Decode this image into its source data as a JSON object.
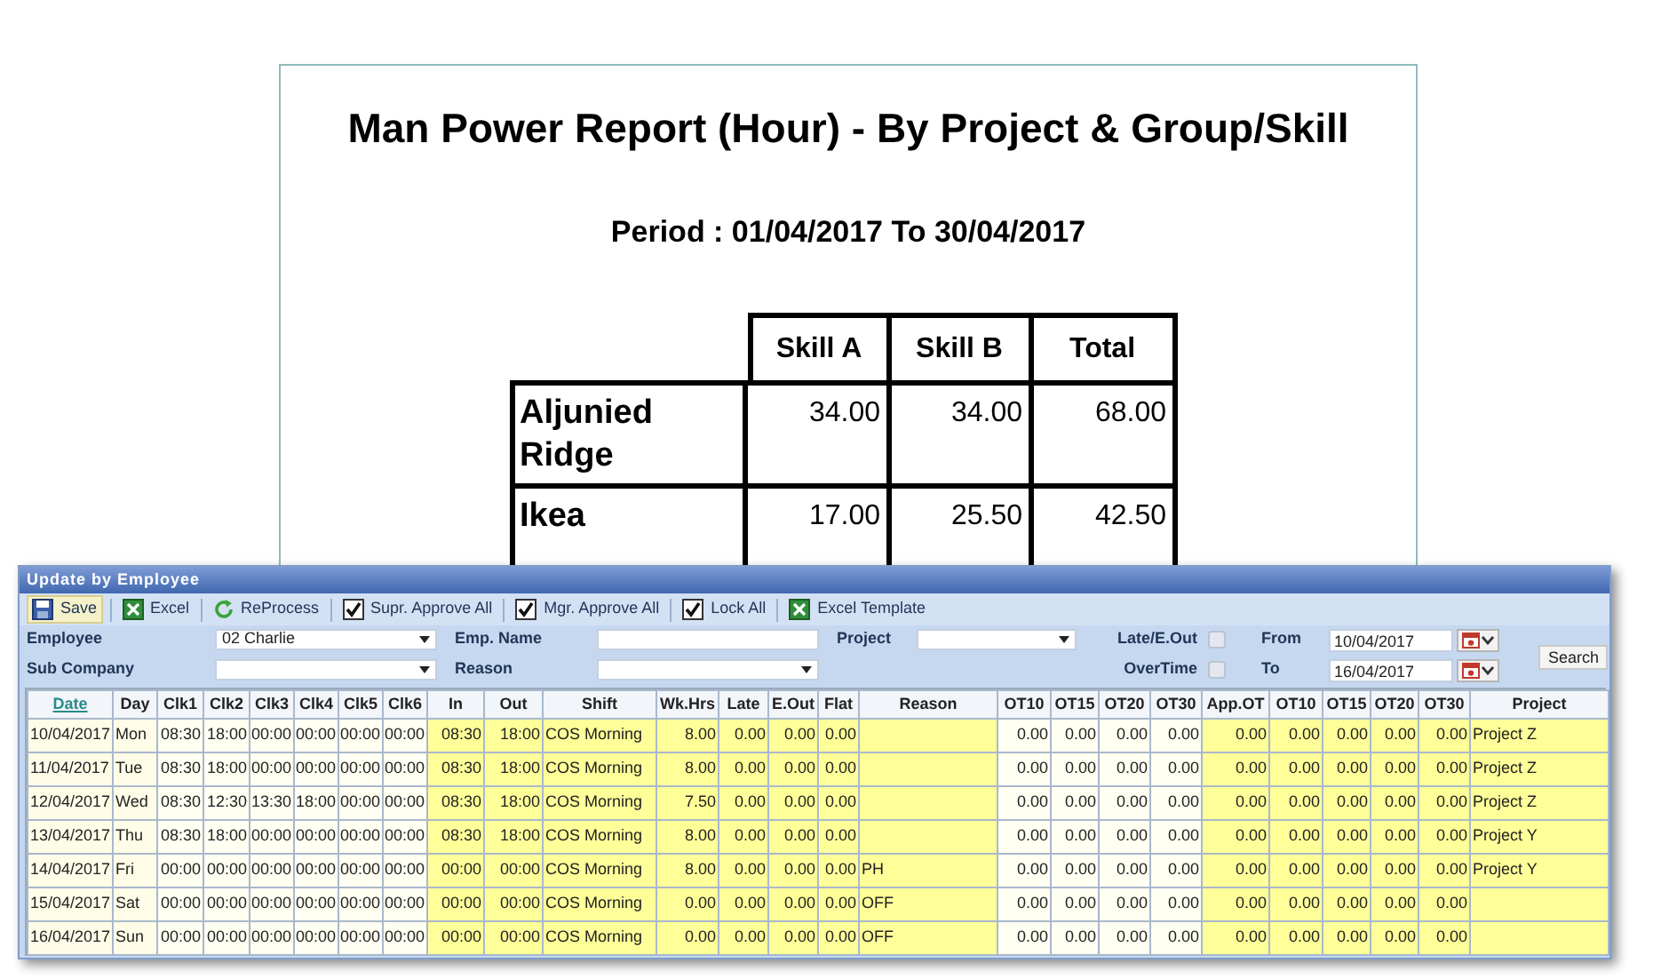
{
  "report": {
    "title": "Man Power Report (Hour) - By Project & Group/Skill",
    "period": "Period : 01/04/2017 To 30/04/2017",
    "columns": [
      "Skill A",
      "Skill B",
      "Total"
    ],
    "rows": [
      {
        "label": "Aljunied Ridge",
        "values": [
          "34.00",
          "34.00",
          "68.00"
        ]
      },
      {
        "label": "Ikea",
        "values": [
          "17.00",
          "25.50",
          "42.50"
        ]
      }
    ]
  },
  "window": {
    "title": "Update by Employee",
    "toolbar": [
      {
        "kind": "save",
        "label": "Save"
      },
      {
        "kind": "excel",
        "label": "Excel"
      },
      {
        "kind": "reprocess",
        "label": "ReProcess"
      },
      {
        "kind": "checkbox",
        "label": "Supr. Approve All",
        "checked": true
      },
      {
        "kind": "checkbox",
        "label": "Mgr. Approve All",
        "checked": true
      },
      {
        "kind": "checkbox",
        "label": "Lock All",
        "checked": true
      },
      {
        "kind": "excel",
        "label": "Excel Template"
      }
    ],
    "filter_groups": [
      [
        {
          "label": "Employee",
          "kind": "dropdown",
          "value": "02 Charlie"
        },
        {
          "label": "Sub Company",
          "kind": "dropdown"
        }
      ],
      [
        {
          "label": "Emp. Name",
          "kind": "input"
        },
        {
          "label": "Reason",
          "kind": "dropdown"
        }
      ],
      [
        {
          "label": "Project",
          "kind": "dropdown"
        }
      ],
      [
        {
          "label": "Late/E.Out",
          "kind": "checkbox",
          "checked": false
        },
        {
          "label": "OverTime",
          "kind": "checkbox",
          "checked": false
        }
      ],
      [
        {
          "label": "From",
          "kind": "date",
          "value": "10/04/2017"
        },
        {
          "label": "To",
          "kind": "date",
          "value": "16/04/2017"
        }
      ]
    ],
    "search_button": "Search",
    "columns": [
      {
        "label": "Date",
        "kind": "date",
        "highlight": false,
        "link": true
      },
      {
        "label": "Day",
        "kind": "day",
        "highlight": false
      },
      {
        "label": "Clk1",
        "kind": "num",
        "highlight": false
      },
      {
        "label": "Clk2",
        "kind": "num",
        "highlight": false
      },
      {
        "label": "Clk3",
        "kind": "num",
        "highlight": false
      },
      {
        "label": "Clk4",
        "kind": "num",
        "highlight": false
      },
      {
        "label": "Clk5",
        "kind": "num",
        "highlight": false
      },
      {
        "label": "Clk6",
        "kind": "num",
        "highlight": false
      },
      {
        "label": "In",
        "kind": "num",
        "highlight": true
      },
      {
        "label": "Out",
        "kind": "num",
        "highlight": true
      },
      {
        "label": "Shift",
        "kind": "text",
        "highlight": true
      },
      {
        "label": "Wk.Hrs",
        "kind": "num",
        "highlight": true
      },
      {
        "label": "Late",
        "kind": "num",
        "highlight": true
      },
      {
        "label": "E.Out",
        "kind": "num",
        "highlight": true
      },
      {
        "label": "Flat",
        "kind": "num",
        "highlight": true
      },
      {
        "label": "Reason",
        "kind": "text",
        "highlight": true
      },
      {
        "label": "OT10",
        "kind": "num",
        "highlight": false
      },
      {
        "label": "OT15",
        "kind": "num",
        "highlight": false
      },
      {
        "label": "OT20",
        "kind": "num",
        "highlight": false
      },
      {
        "label": "OT30",
        "kind": "num",
        "highlight": false
      },
      {
        "label": "App.OT",
        "kind": "num",
        "highlight": true
      },
      {
        "label": "OT10",
        "kind": "num",
        "highlight": true
      },
      {
        "label": "OT15",
        "kind": "num",
        "highlight": true
      },
      {
        "label": "OT20",
        "kind": "num",
        "highlight": true
      },
      {
        "label": "OT30",
        "kind": "num",
        "highlight": true
      },
      {
        "label": "Project",
        "kind": "text",
        "highlight": true
      }
    ],
    "rows": [
      [
        "10/04/2017",
        "Mon",
        "08:30",
        "18:00",
        "00:00",
        "00:00",
        "00:00",
        "00:00",
        "08:30",
        "18:00",
        "COS Morning",
        "8.00",
        "0.00",
        "0.00",
        "0.00",
        "",
        "0.00",
        "0.00",
        "0.00",
        "0.00",
        "0.00",
        "0.00",
        "0.00",
        "0.00",
        "0.00",
        "Project Z"
      ],
      [
        "11/04/2017",
        "Tue",
        "08:30",
        "18:00",
        "00:00",
        "00:00",
        "00:00",
        "00:00",
        "08:30",
        "18:00",
        "COS Morning",
        "8.00",
        "0.00",
        "0.00",
        "0.00",
        "",
        "0.00",
        "0.00",
        "0.00",
        "0.00",
        "0.00",
        "0.00",
        "0.00",
        "0.00",
        "0.00",
        "Project Z"
      ],
      [
        "12/04/2017",
        "Wed",
        "08:30",
        "12:30",
        "13:30",
        "18:00",
        "00:00",
        "00:00",
        "08:30",
        "18:00",
        "COS Morning",
        "7.50",
        "0.00",
        "0.00",
        "0.00",
        "",
        "0.00",
        "0.00",
        "0.00",
        "0.00",
        "0.00",
        "0.00",
        "0.00",
        "0.00",
        "0.00",
        "Project Z"
      ],
      [
        "13/04/2017",
        "Thu",
        "08:30",
        "18:00",
        "00:00",
        "00:00",
        "00:00",
        "00:00",
        "08:30",
        "18:00",
        "COS Morning",
        "8.00",
        "0.00",
        "0.00",
        "0.00",
        "",
        "0.00",
        "0.00",
        "0.00",
        "0.00",
        "0.00",
        "0.00",
        "0.00",
        "0.00",
        "0.00",
        "Project Y"
      ],
      [
        "14/04/2017",
        "Fri",
        "00:00",
        "00:00",
        "00:00",
        "00:00",
        "00:00",
        "00:00",
        "00:00",
        "00:00",
        "COS Morning",
        "8.00",
        "0.00",
        "0.00",
        "0.00",
        "PH",
        "0.00",
        "0.00",
        "0.00",
        "0.00",
        "0.00",
        "0.00",
        "0.00",
        "0.00",
        "0.00",
        "Project Y"
      ],
      [
        "15/04/2017",
        "Sat",
        "00:00",
        "00:00",
        "00:00",
        "00:00",
        "00:00",
        "00:00",
        "00:00",
        "00:00",
        "COS Morning",
        "0.00",
        "0.00",
        "0.00",
        "0.00",
        "OFF",
        "0.00",
        "0.00",
        "0.00",
        "0.00",
        "0.00",
        "0.00",
        "0.00",
        "0.00",
        "0.00",
        ""
      ],
      [
        "16/04/2017",
        "Sun",
        "00:00",
        "00:00",
        "00:00",
        "00:00",
        "00:00",
        "00:00",
        "00:00",
        "00:00",
        "COS Morning",
        "0.00",
        "0.00",
        "0.00",
        "0.00",
        "OFF",
        "0.00",
        "0.00",
        "0.00",
        "0.00",
        "0.00",
        "0.00",
        "0.00",
        "0.00",
        "0.00",
        ""
      ]
    ]
  }
}
